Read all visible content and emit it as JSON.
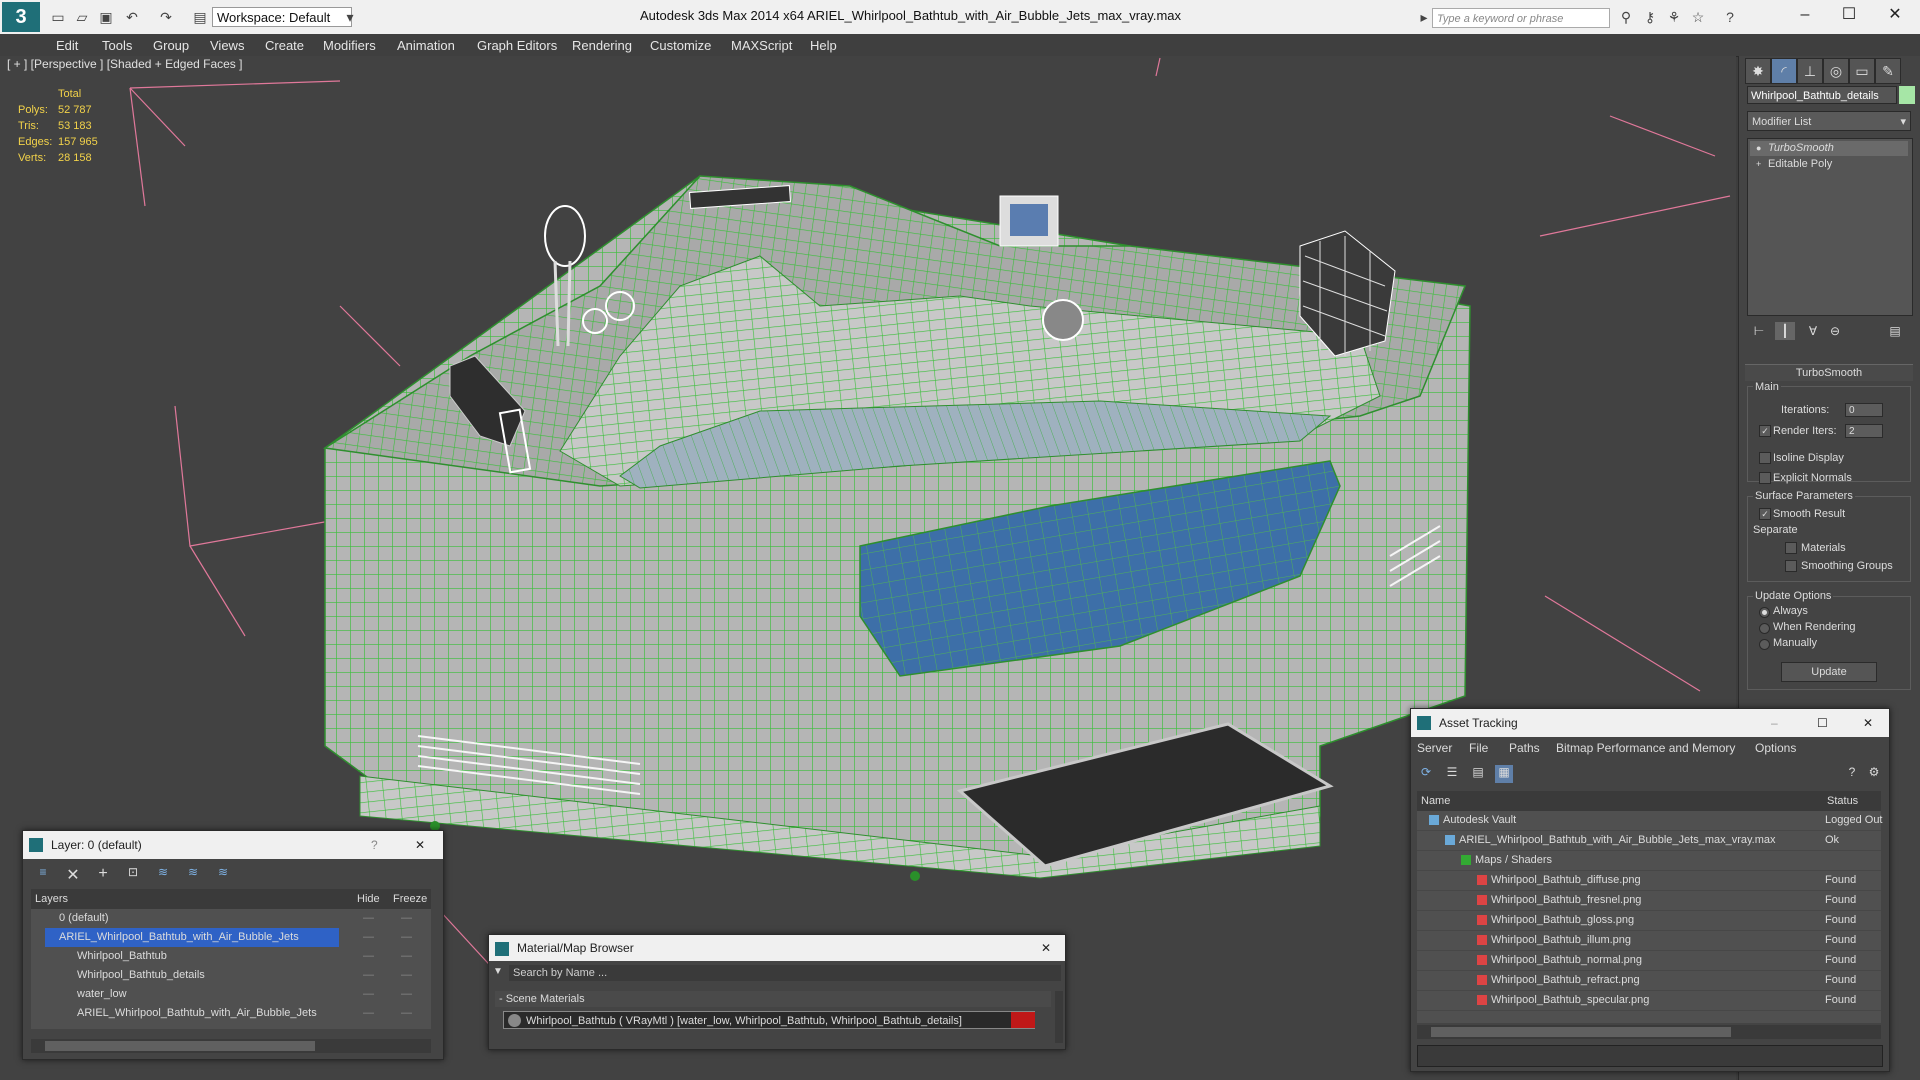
{
  "app": {
    "title": "Autodesk 3ds Max  2014 x64      ARIEL_Whirlpool_Bathtub_with_Air_Bubble_Jets_max_vray.max",
    "logo": "3",
    "workspace": "Workspace: Default",
    "search_placeholder": "Type a keyword or phrase"
  },
  "menu": [
    "Edit",
    "Tools",
    "Group",
    "Views",
    "Create",
    "Modifiers",
    "Animation",
    "Graph Editors",
    "Rendering",
    "Customize",
    "MAXScript",
    "Help"
  ],
  "viewport": {
    "label": "[ + ] [Perspective ] [Shaded + Edged Faces ]",
    "stats": {
      "header": "Total",
      "rows": [
        {
          "label": "Polys:",
          "value": "52 787"
        },
        {
          "label": "Tris:",
          "value": "53 183"
        },
        {
          "label": "Edges:",
          "value": "157 965"
        },
        {
          "label": "Verts:",
          "value": "28 158"
        }
      ]
    }
  },
  "command_panel": {
    "object_name": "Whirlpool_Bathtub_details",
    "object_color": "#a6e6a6",
    "modifier_list": "Modifier List",
    "stack": [
      "TurboSmooth",
      "Editable Poly"
    ],
    "turbosmooth": {
      "header": "TurboSmooth",
      "main": "Main",
      "iterations_label": "Iterations:",
      "iterations_value": "0",
      "render_iters_label": "Render Iters:",
      "render_iters_value": "2",
      "isoline": "Isoline Display",
      "explicit_normals": "Explicit Normals",
      "surface_params": "Surface Parameters",
      "smooth_result": "Smooth Result",
      "separate": "Separate",
      "materials": "Materials",
      "smoothing_groups": "Smoothing Groups",
      "update_options": "Update Options",
      "always": "Always",
      "when_rendering": "When Rendering",
      "manually": "Manually",
      "update_button": "Update"
    }
  },
  "asset_tracking": {
    "title": "Asset Tracking",
    "menu": [
      "Server",
      "File",
      "Paths",
      "Bitmap Performance and Memory",
      "Options"
    ],
    "col_name": "Name",
    "col_status": "Status",
    "rows": [
      {
        "name": "Autodesk Vault",
        "status": "Logged Out",
        "indent": 1
      },
      {
        "name": "ARIEL_Whirlpool_Bathtub_with_Air_Bubble_Jets_max_vray.max",
        "status": "Ok",
        "indent": 2
      },
      {
        "name": "Maps / Shaders",
        "status": "",
        "indent": 3
      },
      {
        "name": "Whirlpool_Bathtub_diffuse.png",
        "status": "Found",
        "indent": 4
      },
      {
        "name": "Whirlpool_Bathtub_fresnel.png",
        "status": "Found",
        "indent": 4
      },
      {
        "name": "Whirlpool_Bathtub_gloss.png",
        "status": "Found",
        "indent": 4
      },
      {
        "name": "Whirlpool_Bathtub_illum.png",
        "status": "Found",
        "indent": 4
      },
      {
        "name": "Whirlpool_Bathtub_normal.png",
        "status": "Found",
        "indent": 4
      },
      {
        "name": "Whirlpool_Bathtub_refract.png",
        "status": "Found",
        "indent": 4
      },
      {
        "name": "Whirlpool_Bathtub_specular.png",
        "status": "Found",
        "indent": 4
      }
    ]
  },
  "layer_dialog": {
    "title": "Layer: 0 (default)",
    "help": "?",
    "col_layers": "Layers",
    "col_hide": "Hide",
    "col_freeze": "Freeze",
    "rows": [
      {
        "name": "0 (default)",
        "indent": 1,
        "selected": false
      },
      {
        "name": "ARIEL_Whirlpool_Bathtub_with_Air_Bubble_Jets",
        "indent": 1,
        "selected": true
      },
      {
        "name": "Whirlpool_Bathtub",
        "indent": 2,
        "selected": false
      },
      {
        "name": "Whirlpool_Bathtub_details",
        "indent": 2,
        "selected": false
      },
      {
        "name": "water_low",
        "indent": 2,
        "selected": false
      },
      {
        "name": "ARIEL_Whirlpool_Bathtub_with_Air_Bubble_Jets",
        "indent": 2,
        "selected": false
      }
    ]
  },
  "material_browser": {
    "title": "Material/Map Browser",
    "search_placeholder": "Search by Name ...",
    "section": "- Scene Materials",
    "item": "Whirlpool_Bathtub  ( VRayMtl )  [water_low, Whirlpool_Bathtub, Whirlpool_Bathtub_details]"
  },
  "colors": {
    "wire": "#3bbf3b",
    "mesh": "#b9b9b9",
    "glass": "#3d6fa8",
    "selection": "#2f62c6",
    "stats": "#f2d24a"
  }
}
